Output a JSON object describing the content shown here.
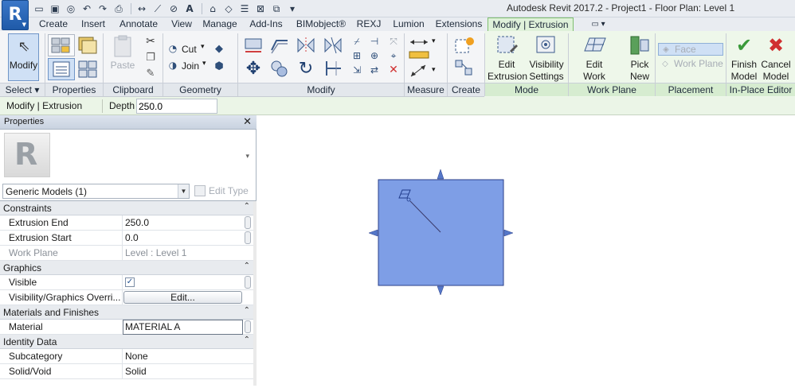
{
  "title_bar": {
    "app_button_label": "R",
    "window_title": "Autodesk Revit 2017.2 -     Project1 - Floor Plan: Level 1"
  },
  "tabs": [
    {
      "label": "Create"
    },
    {
      "label": "Insert"
    },
    {
      "label": "Annotate"
    },
    {
      "label": "View"
    },
    {
      "label": "Manage"
    },
    {
      "label": "Add-Ins"
    },
    {
      "label": "BIMobject®"
    },
    {
      "label": "REXJ"
    },
    {
      "label": "Lumion"
    },
    {
      "label": "Extensions"
    },
    {
      "label": "Modify | Extrusion",
      "active": true
    }
  ],
  "ribbon": {
    "select": {
      "modify_label": "Modify",
      "panel_label": "Select ▾"
    },
    "properties": {
      "panel_label": "Properties"
    },
    "clipboard": {
      "paste_label": "Paste",
      "panel_label": "Clipboard"
    },
    "geometry": {
      "cut_label": "Cut",
      "join_label": "Join",
      "panel_label": "Geometry"
    },
    "modify": {
      "panel_label": "Modify"
    },
    "measure": {
      "panel_label": "Measure"
    },
    "create": {
      "panel_label": "Create"
    },
    "mode": {
      "edit_extrusion_line1": "Edit",
      "edit_extrusion_line2": "Extrusion",
      "visibility_line1": "Visibility",
      "visibility_line2": "Settings",
      "panel_label": "Mode"
    },
    "work_plane": {
      "edit_wp_line1": "Edit",
      "edit_wp_line2": "Work Plane",
      "pick_new_line1": "Pick",
      "pick_new_line2": "New",
      "panel_label": "Work Plane"
    },
    "placement": {
      "face_label": "Face",
      "work_plane_label": "Work Plane",
      "panel_label": "Placement"
    },
    "in_place_editor": {
      "finish_line1": "Finish",
      "finish_line2": "Model",
      "cancel_line1": "Cancel",
      "cancel_line2": "Model",
      "panel_label": "In-Place Editor"
    }
  },
  "options_bar": {
    "mode_label": "Modify | Extrusion",
    "depth_label": "Depth",
    "depth_value": "250.0"
  },
  "properties": {
    "header": "Properties",
    "type_selector": "Generic Models (1)",
    "edit_type_label": "Edit Type",
    "categories": {
      "constraints": "Constraints",
      "graphics": "Graphics",
      "materials": "Materials and Finishes",
      "identity": "Identity Data"
    },
    "rows": {
      "extrusion_end": {
        "key": "Extrusion End",
        "value": "250.0"
      },
      "extrusion_start": {
        "key": "Extrusion Start",
        "value": "0.0"
      },
      "work_plane": {
        "key": "Work Plane",
        "value": "Level : Level 1"
      },
      "visible": {
        "key": "Visible",
        "checked": true
      },
      "vg_overrides": {
        "key": "Visibility/Graphics Overri...",
        "button": "Edit..."
      },
      "material": {
        "key": "Material",
        "value": "MATERIAL A"
      },
      "subcategory": {
        "key": "Subcategory",
        "value": "None"
      },
      "solid_void": {
        "key": "Solid/Void",
        "value": "Solid"
      }
    }
  },
  "colors": {
    "extrusion_fill": "#7e9ee6",
    "extrusion_stroke": "#2a3f8a",
    "context_tab": "#dff1da",
    "finish_check": "#3a9a3a",
    "cancel_x": "#d03030"
  }
}
